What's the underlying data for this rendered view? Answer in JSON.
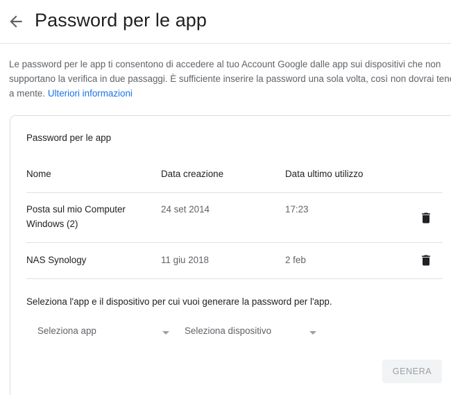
{
  "header": {
    "title": "Password per le app",
    "back_icon": "arrow-left-icon"
  },
  "intro": {
    "text": "Le password per le app ti consentono di accedere al tuo Account Google dalle app sui dispositivi che non supportano la verifica in due passaggi. È sufficiente inserire la password una sola volta, così non dovrai tenerla a mente. ",
    "link_label": "Ulteriori informazioni"
  },
  "card": {
    "title": "Password per le app",
    "columns": {
      "name": "Nome",
      "created": "Data creazione",
      "last_used": "Data ultimo utilizzo"
    },
    "rows": [
      {
        "name": "Posta sul mio Computer Windows (2)",
        "created": "24 set 2014",
        "last_used": "17:23",
        "action_icon": "trash-icon"
      },
      {
        "name": "NAS Synology",
        "created": "11 giu 2018",
        "last_used": "2 feb",
        "action_icon": "trash-icon"
      }
    ],
    "generate": {
      "instructions": "Seleziona l'app e il dispositivo per cui vuoi generare la password per l'app.",
      "app_select": "Seleziona app",
      "device_select": "Seleziona dispositivo",
      "button_label": "GENERA"
    }
  },
  "colors": {
    "link": "#1a73e8",
    "text": "#202124",
    "muted": "#5f6368",
    "divider": "#e0e0e0",
    "button_disabled_bg": "#f1f3f4",
    "button_disabled_text": "#9aa0a6"
  }
}
